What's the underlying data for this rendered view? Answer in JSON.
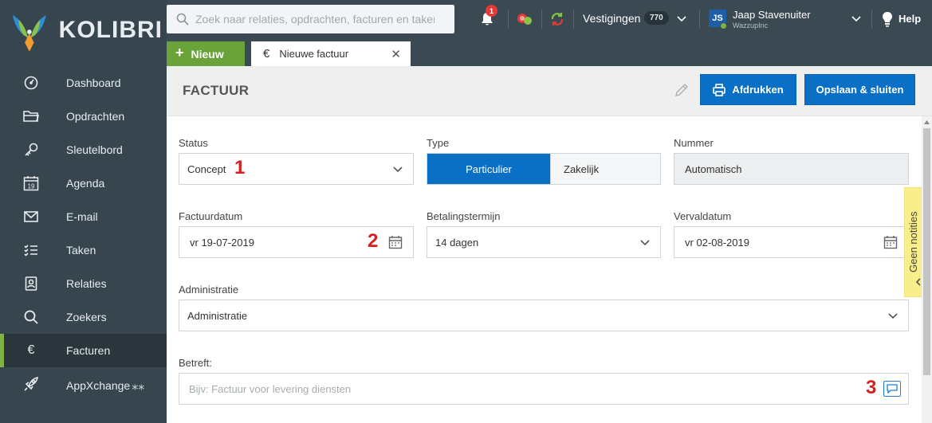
{
  "brand": {
    "name": "KOLIBRI"
  },
  "search": {
    "placeholder": "Zoek naar relaties, opdrachten, facturen en taken"
  },
  "notifications": {
    "count": "1"
  },
  "branches": {
    "label": "Vestigingen",
    "count": "770"
  },
  "user": {
    "initials": "JS",
    "name": "Jaap Stavenuiter",
    "company": "WazzupInc"
  },
  "help": {
    "label": "Help"
  },
  "sidebar": {
    "items": [
      {
        "label": "Dashboard",
        "icon": "dashboard-icon"
      },
      {
        "label": "Opdrachten",
        "icon": "folder-icon"
      },
      {
        "label": "Sleutelbord",
        "icon": "key-icon"
      },
      {
        "label": "Agenda",
        "icon": "calendar-icon",
        "date": "19"
      },
      {
        "label": "E-mail",
        "icon": "mail-icon"
      },
      {
        "label": "Taken",
        "icon": "tasks-icon"
      },
      {
        "label": "Relaties",
        "icon": "contacts-icon"
      },
      {
        "label": "Zoekers",
        "icon": "search-icon"
      },
      {
        "label": "Facturen",
        "icon": "euro-icon",
        "active": true
      },
      {
        "label": "AppXchange",
        "icon": "rocket-icon",
        "suffix": "⁎⁎"
      }
    ]
  },
  "tabs": {
    "new_label": "Nieuw",
    "active_tab": {
      "label": "Nieuwe factuur",
      "icon": "€",
      "close": "✕"
    }
  },
  "page": {
    "title": "FACTUUR",
    "print_label": "Afdrukken",
    "save_label": "Opslaan & sluiten"
  },
  "form": {
    "status": {
      "label": "Status",
      "value": "Concept"
    },
    "type": {
      "label": "Type",
      "options": [
        "Particulier",
        "Zakelijk"
      ],
      "selected": "Particulier"
    },
    "number": {
      "label": "Nummer",
      "value": "Automatisch"
    },
    "invoice_date": {
      "label": "Factuurdatum",
      "value": "vr 19-07-2019"
    },
    "payment_term": {
      "label": "Betalingstermijn",
      "value": "14 dagen"
    },
    "due_date": {
      "label": "Vervaldatum",
      "value": "vr 02-08-2019"
    },
    "administration": {
      "label": "Administratie",
      "value": "Administratie"
    },
    "subject": {
      "label": "Betreft:",
      "placeholder": "Bijv: Factuur voor levering diensten"
    }
  },
  "annotations": [
    "1",
    "2",
    "3"
  ],
  "notes_panel": {
    "label": "Geen notities"
  },
  "colors": {
    "primary": "#0a70c6",
    "green": "#6aa339",
    "sidebar": "#37454e",
    "annotation": "#d62020",
    "notes": "#f8ef8c"
  }
}
